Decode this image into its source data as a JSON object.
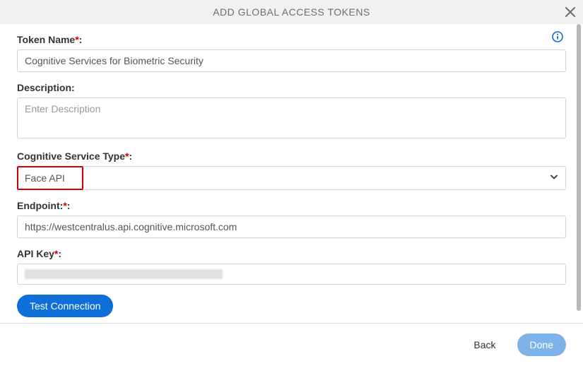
{
  "header": {
    "title": "ADD GLOBAL ACCESS TOKENS"
  },
  "form": {
    "token_name": {
      "label": "Token Name",
      "value": "Cognitive Services for Biometric Security"
    },
    "description": {
      "label": "Description:",
      "placeholder": "Enter Description",
      "value": ""
    },
    "service_type": {
      "label": "Cognitive Service Type",
      "value": "Face API"
    },
    "endpoint": {
      "label": "Endpoint:",
      "value": "https://westcentralus.api.cognitive.microsoft.com"
    },
    "api_key": {
      "label": "API Key"
    },
    "test_connection_label": "Test Connection"
  },
  "footer": {
    "back_label": "Back",
    "done_label": "Done"
  }
}
